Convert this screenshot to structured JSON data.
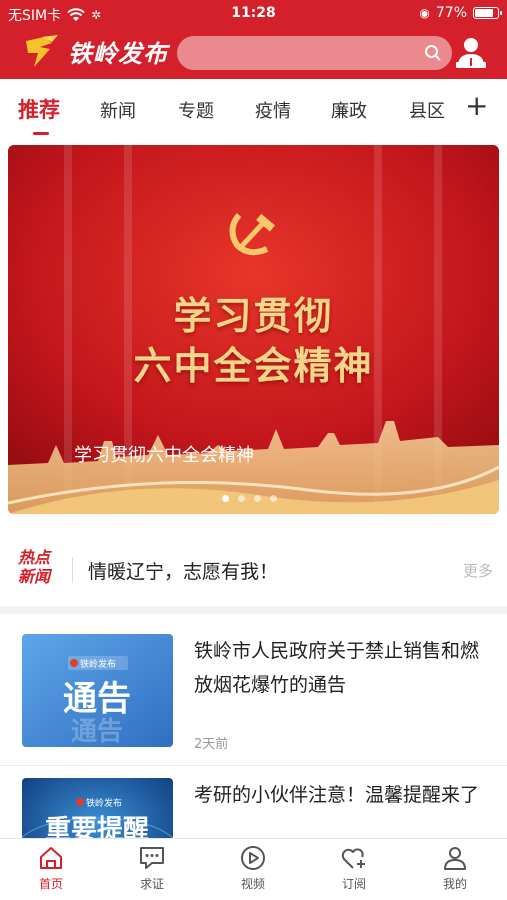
{
  "status_bar": {
    "carrier": "无SIM卡",
    "time": "11:28",
    "battery": "77%",
    "battery_level": 0.77
  },
  "header": {
    "app_name": "铁岭发布",
    "search_placeholder": "",
    "icons": {
      "search": "search-icon",
      "user": "user-icon",
      "logo": "logo-mark"
    }
  },
  "tabs": [
    {
      "label": "推荐",
      "active": true
    },
    {
      "label": "新闻"
    },
    {
      "label": "专题"
    },
    {
      "label": "疫情"
    },
    {
      "label": "廉政"
    },
    {
      "label": "县区"
    }
  ],
  "tabs_more": "+",
  "banner": {
    "headline_line1": "学习贯彻",
    "headline_line2": "六中全会精神",
    "caption": "学习贯彻六中全会精神",
    "slides": 4,
    "active_slide": 1
  },
  "hot_news": {
    "badge_line1": "热点",
    "badge_line2": "新闻",
    "text": "情暖辽宁，志愿有我！",
    "more": "更多"
  },
  "news": [
    {
      "title": "铁岭市人民政府关于禁止销售和燃放烟花爆竹的通告",
      "time": "2天前",
      "thumb_logo": "铁岭发布",
      "thumb_text": "通告"
    },
    {
      "title": "考研的小伙伴注意！温馨提醒来了",
      "time": "",
      "thumb_logo": "铁岭发布",
      "thumb_text": "重要提醒"
    }
  ],
  "bottom_nav": [
    {
      "label": "首页",
      "icon": "home-icon",
      "active": true
    },
    {
      "label": "求证",
      "icon": "chat-icon"
    },
    {
      "label": "视频",
      "icon": "play-icon"
    },
    {
      "label": "订阅",
      "icon": "heart-plus-icon"
    },
    {
      "label": "我的",
      "icon": "person-icon"
    }
  ],
  "colors": {
    "brand_red": "#d4202a",
    "banner_gold": "#f5d58a"
  }
}
